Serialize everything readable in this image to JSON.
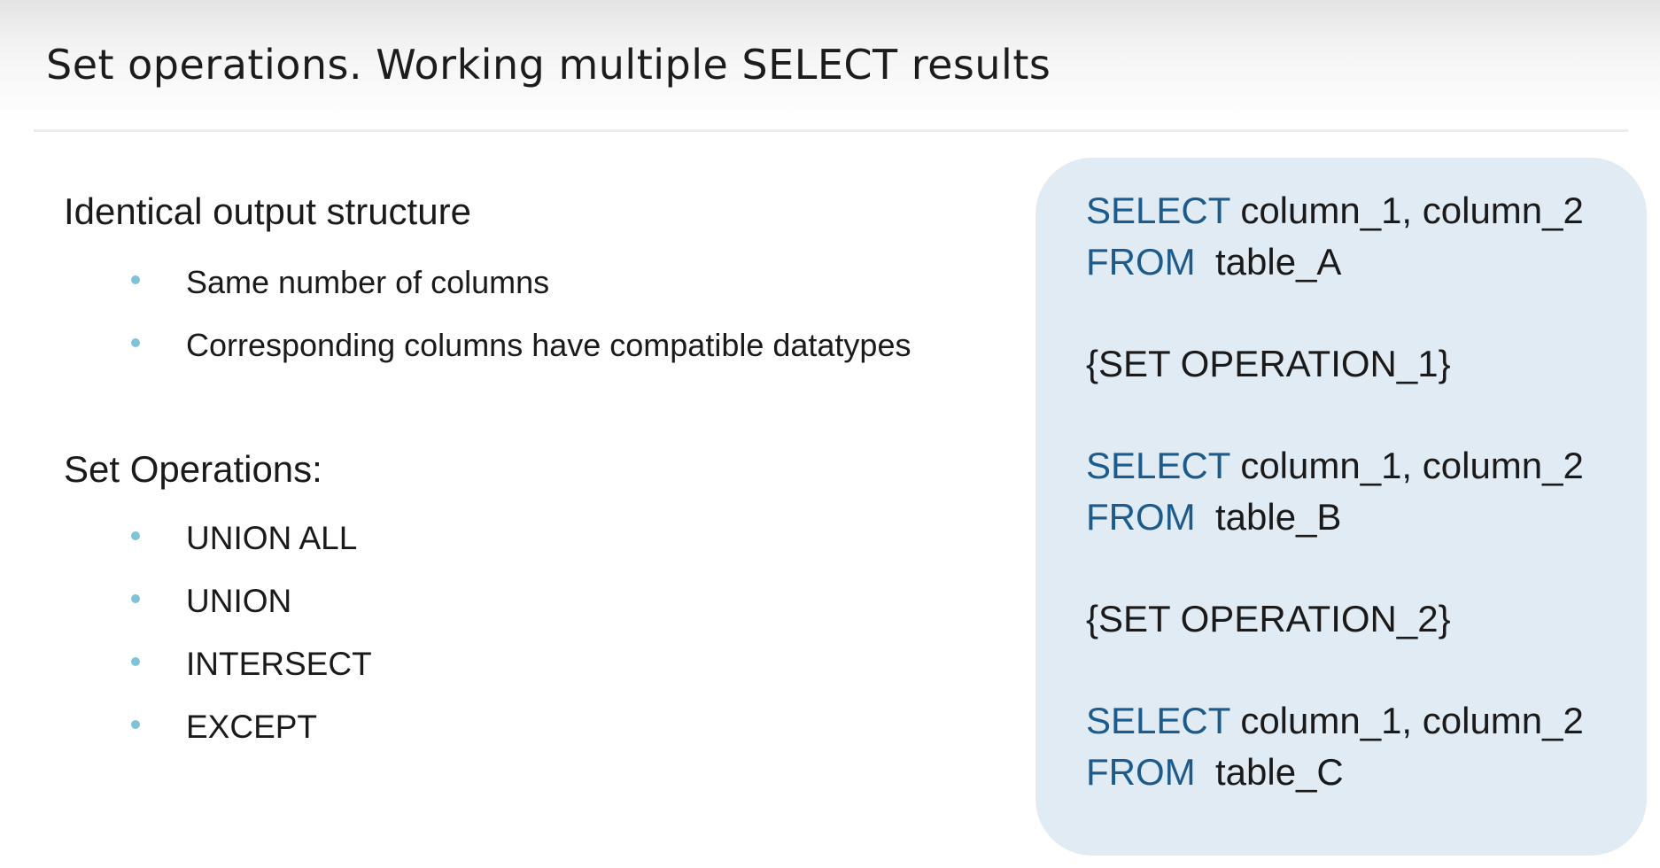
{
  "slide": {
    "title": "Set operations. Working multiple SELECT results"
  },
  "left": {
    "structure": {
      "heading": "Identical output structure",
      "bullets": [
        "Same number of columns",
        "Corresponding columns have compatible datatypes"
      ]
    },
    "operations": {
      "heading": "Set Operations:",
      "bullets": [
        "UNION ALL",
        "UNION",
        "INTERSECT",
        "EXCEPT"
      ]
    }
  },
  "code": {
    "select_kw": "SELECT",
    "from_kw": "FROM",
    "columns": "column_1, column_2",
    "blocks": [
      {
        "table": "table_A"
      },
      {
        "op": "{SET OPERATION_1}"
      },
      {
        "table": "table_B"
      },
      {
        "op": "{SET OPERATION_2}"
      },
      {
        "table": "table_C"
      }
    ]
  },
  "colors": {
    "keyword": "#1d5b8c",
    "panel": "#e0ebf3",
    "bullet": "#7ec3d6"
  }
}
